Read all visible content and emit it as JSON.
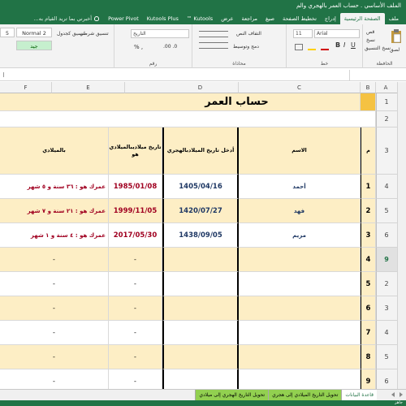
{
  "window": {
    "title": "الملف الأساسي . حساب العمر بالهجري والم"
  },
  "ribbon_tabs": [
    "ملف",
    "الصفحة الرئيسية",
    "إدراج",
    "تخطيط الصفحة",
    "صيغ",
    "مراجعة",
    "عرض",
    "Kutools ™",
    "Kutools Plus",
    "Power Pivot"
  ],
  "tell_me": "أخبرني بما تريد القيام به...",
  "ribbon": {
    "paste_label": "لصق",
    "font_name": "Arial",
    "font_size": "11",
    "date_format": "التاريخ",
    "wrap_label": "التفاف النص",
    "merge_label": "دمج وتوسيط",
    "number_group": "رقم",
    "alignment_group": "محاذاة",
    "font_group": "خط",
    "clipboard_group": "الحافظة",
    "format_label": "نسخ التنسيق",
    "copy_label": "نسخ",
    "cut_label": "قص",
    "normal_style": "Normal 2",
    "style_5": "5",
    "style_good": "جيد",
    "conditional_label": "تنسيق شرطي",
    "table_label": "تنسيق كجدول"
  },
  "columns": [
    "F",
    "E",
    "D",
    "C",
    "B",
    "A"
  ],
  "rows": [
    "1",
    "2",
    "3",
    "4",
    "5",
    "6",
    "7",
    "8",
    "9",
    "1",
    "2",
    "3",
    "4",
    "5",
    "6",
    "7",
    "8",
    "9"
  ],
  "sheet": {
    "title": "حساب العمر",
    "headers": {
      "num": "م",
      "name": "الاسم",
      "hijri_birth_1": "أدخل تاريخ الميلاد",
      "hijri_birth_2": "بالهجري",
      "greg_1": "تاريخ ميلادي",
      "greg_2": "بالميلادي هو",
      "age": "بالميلادي"
    },
    "people": [
      {
        "num": "1",
        "name": "أحمد",
        "hijri": "1405/04/16",
        "greg": "1985/01/08",
        "age": "عمرك هو : ٣٦ سنة و ٥ شهر"
      },
      {
        "num": "2",
        "name": "فهد",
        "hijri": "1420/07/27",
        "greg": "1999/11/05",
        "age": "عمرك هو : ٢١ سنة و ٧ شهر"
      },
      {
        "num": "3",
        "name": "مريم",
        "hijri": "1438/09/05",
        "greg": "2017/05/30",
        "age": "عمرك هو : ٤ سنة و ١ شهر"
      }
    ],
    "empty_rows": [
      "4",
      "5",
      "6",
      "7",
      "8",
      "9"
    ],
    "dash": "-"
  },
  "sheet_tabs": [
    "قاعدة البيانات",
    "تحويل التاريخ الميلادي إلى هجري",
    "تحويل التاريخ الهجري إلى ميلادي"
  ],
  "status": "جاهز",
  "colors": {
    "excel_green": "#217346",
    "yellow_fill": "#fdeec5",
    "header_gold": "#f5c242",
    "name_blue": "#1f3864",
    "date_red": "#a00020",
    "sheet_tab_green": "#92d050"
  }
}
